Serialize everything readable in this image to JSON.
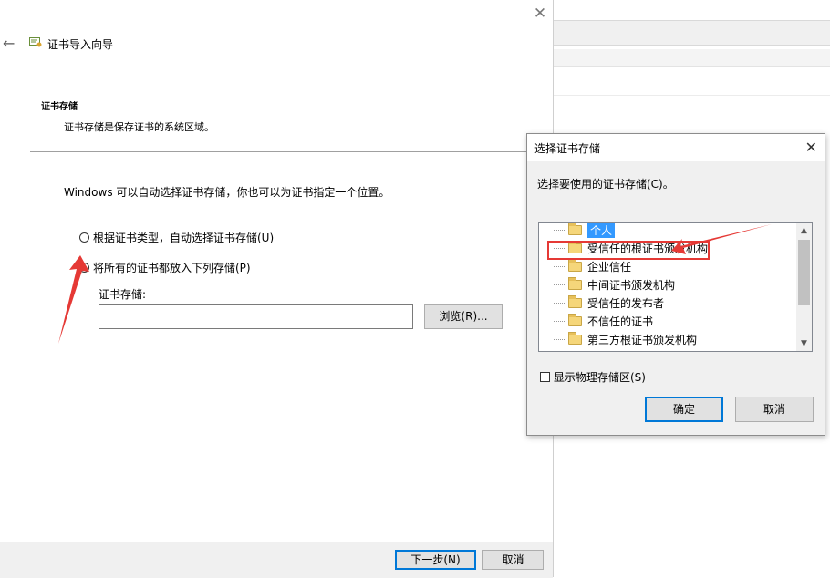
{
  "wizard": {
    "title": "证书导入向导",
    "section_title": "证书存储",
    "section_desc": "证书存储是保存证书的系统区域。",
    "intro": "Windows 可以自动选择证书存储，你也可以为证书指定一个位置。",
    "radio_auto": "根据证书类型，自动选择证书存储(U)",
    "radio_manual": "将所有的证书都放入下列存储(P)",
    "store_label": "证书存储:",
    "store_value": "",
    "browse_label": "浏览(R)...",
    "next_label": "下一步(N)",
    "cancel_label": "取消"
  },
  "dialog": {
    "title": "选择证书存储",
    "prompt": "选择要使用的证书存储(C)。",
    "items": [
      "个人",
      "受信任的根证书颁发机构",
      "企业信任",
      "中间证书颁发机构",
      "受信任的发布者",
      "不信任的证书",
      "第三方根证书颁发机构"
    ],
    "selected_index": 0,
    "highlighted_index": 1,
    "show_physical": "显示物理存储区(S)",
    "ok_label": "确定",
    "cancel_label": "取消"
  },
  "colors": {
    "accent": "#0078d7",
    "selection": "#3399ff",
    "annotation": "#e53935"
  }
}
